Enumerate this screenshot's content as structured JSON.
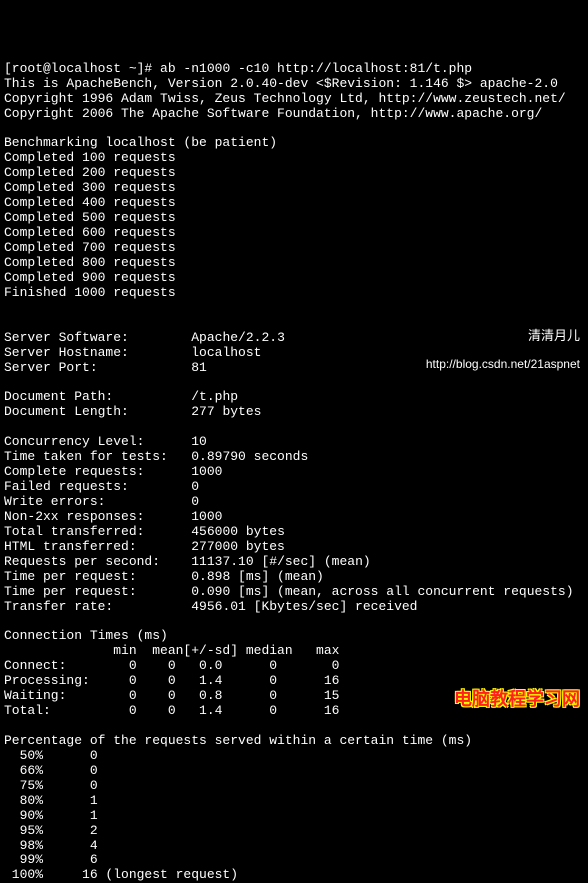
{
  "prompt": "[root@localhost ~]# ",
  "command": "ab -n1000 -c10 http://localhost:81/t.php",
  "header": {
    "line1": "This is ApacheBench, Version 2.0.40-dev <$Revision: 1.146 $> apache-2.0",
    "line2": "Copyright 1996 Adam Twiss, Zeus Technology Ltd, http://www.zeustech.net/",
    "line3": "Copyright 2006 The Apache Software Foundation, http://www.apache.org/"
  },
  "benchmark_line": "Benchmarking localhost (be patient)",
  "progress": [
    "Completed 100 requests",
    "Completed 200 requests",
    "Completed 300 requests",
    "Completed 400 requests",
    "Completed 500 requests",
    "Completed 600 requests",
    "Completed 700 requests",
    "Completed 800 requests",
    "Completed 900 requests",
    "Finished 1000 requests"
  ],
  "server": {
    "software_label": "Server Software:",
    "software": "Apache/2.2.3",
    "hostname_label": "Server Hostname:",
    "hostname": "localhost",
    "port_label": "Server Port:",
    "port": "81"
  },
  "doc": {
    "path_label": "Document Path:",
    "path": "/t.php",
    "length_label": "Document Length:",
    "length": "277 bytes"
  },
  "stats": {
    "concurrency_label": "Concurrency Level:",
    "concurrency": "10",
    "time_taken_label": "Time taken for tests:",
    "time_taken": "0.89790 seconds",
    "complete_label": "Complete requests:",
    "complete": "1000",
    "failed_label": "Failed requests:",
    "failed": "0",
    "write_errors_label": "Write errors:",
    "write_errors": "0",
    "non2xx_label": "Non-2xx responses:",
    "non2xx": "1000",
    "total_trans_label": "Total transferred:",
    "total_trans": "456000 bytes",
    "html_trans_label": "HTML transferred:",
    "html_trans": "277000 bytes",
    "rps_label": "Requests per second:",
    "rps": "11137.10 [#/sec] (mean)",
    "tpr1_label": "Time per request:",
    "tpr1": "0.898 [ms] (mean)",
    "tpr2_label": "Time per request:",
    "tpr2": "0.090 [ms] (mean, across all concurrent requests)",
    "transfer_label": "Transfer rate:",
    "transfer": "4956.01 [Kbytes/sec] received"
  },
  "conn_header": "Connection Times (ms)",
  "conn_cols": "              min  mean[+/-sd] median   max",
  "conn_rows": {
    "connect": "Connect:        0    0   0.0      0       0",
    "processing": "Processing:     0    0   1.4      0      16",
    "waiting": "Waiting:        0    0   0.8      0      15",
    "total": "Total:          0    0   1.4      0      16"
  },
  "pct_header": "Percentage of the requests served within a certain time (ms)",
  "pct": [
    "  50%      0",
    "  66%      0",
    "  75%      0",
    "  80%      1",
    "  90%      1",
    "  95%      2",
    "  98%      4",
    "  99%      6",
    " 100%     16 (longest request)"
  ],
  "watermark1": {
    "cn": "清清月儿",
    "url": "http://blog.csdn.net/21aspnet"
  },
  "watermark2": "电脑教程学习网"
}
